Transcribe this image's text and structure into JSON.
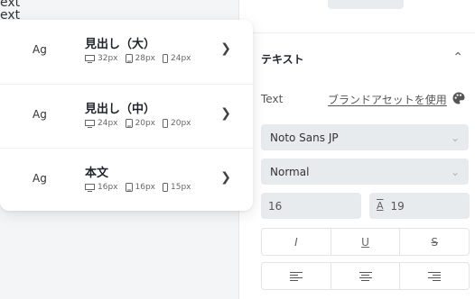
{
  "background": {
    "overflow_text": "ext\next"
  },
  "panel": {
    "section_title": "テキスト",
    "text_label": "Text",
    "brand_asset_link": "ブランドアセットを使用",
    "font_family": "Noto Sans JP",
    "font_weight": "Normal",
    "font_size": "16",
    "line_height": "19",
    "style_buttons": {
      "italic": "I",
      "underline": "U",
      "strike": "S"
    }
  },
  "text_styles": [
    {
      "preview": "Ag",
      "name": "見出し（大）",
      "desktop": "32px",
      "tablet": "28px",
      "mobile": "24px"
    },
    {
      "preview": "Ag",
      "name": "見出し（中）",
      "desktop": "24px",
      "tablet": "20px",
      "mobile": "20px"
    },
    {
      "preview": "Ag",
      "name": "本文",
      "desktop": "16px",
      "tablet": "16px",
      "mobile": "15px"
    }
  ],
  "colors": {
    "panel_bg": "#ffffff",
    "field_bg": "#e8ebee",
    "page_bg": "#f4f5f7"
  }
}
